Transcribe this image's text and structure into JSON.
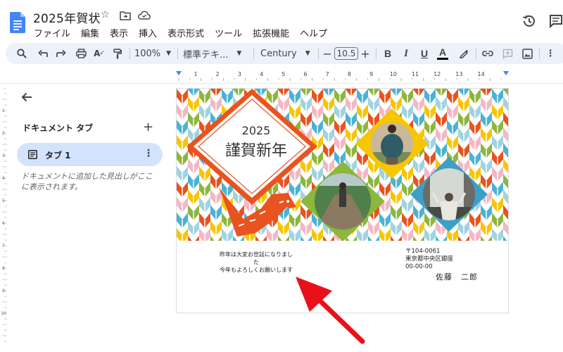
{
  "app": {
    "title": "2025年賀状",
    "menu": [
      "ファイル",
      "編集",
      "表示",
      "挿入",
      "表示形式",
      "ツール",
      "拡張機能",
      "ヘルプ"
    ]
  },
  "toolbar": {
    "zoom": "100%",
    "style": "標準テキ...",
    "font": "Century",
    "font_size": "10.5",
    "bold": "B",
    "italic": "I",
    "underline": "U",
    "text_color": "A"
  },
  "ruler": {
    "labels": [
      "1",
      "2",
      "3",
      "4",
      "5",
      "6",
      "7",
      "8",
      "9",
      "10",
      "11",
      "12",
      "13",
      "14"
    ],
    "vlabels": [
      "1",
      "2",
      "3",
      "4",
      "5",
      "6",
      "7",
      "8",
      "9",
      "10"
    ]
  },
  "sidebar": {
    "heading": "ドキュメント タブ",
    "tab_label": "タブ 1",
    "hint": "ドキュメントに追加した見出しがここに表示されます。"
  },
  "card": {
    "year": "2025",
    "greeting_title": "謹賀新年",
    "message_lines": [
      "昨年は大変お世話になりまし",
      "た",
      "今年もよろしくお願いします"
    ],
    "address_lines": [
      "〒104-0061",
      "東京都中央区銀座",
      "00-00-00"
    ],
    "sender": "佐藤　二郎"
  },
  "colors": {
    "accent": "#e8531f",
    "tab_active": "#d3e3fd",
    "toolbar_bg": "#edf2fa",
    "arrow": "#e8111a",
    "pattern": [
      "#e8531f",
      "#f5b7c5",
      "#4ab3d4",
      "#f7c600",
      "#8db63c",
      "#9fd3e0"
    ]
  }
}
